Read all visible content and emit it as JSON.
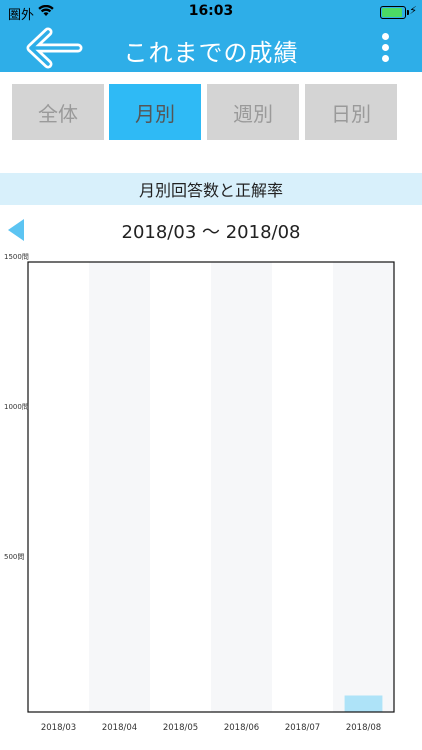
{
  "status": {
    "carrier": "圏外",
    "time": "16:03"
  },
  "nav": {
    "title": "これまでの成績",
    "back_icon": "arrow-left-icon",
    "menu_icon": "more-vertical-icon"
  },
  "tabs": [
    {
      "label": "全体",
      "active": false
    },
    {
      "label": "月別",
      "active": true
    },
    {
      "label": "週別",
      "active": false
    },
    {
      "label": "日別",
      "active": false
    }
  ],
  "section": {
    "title": "月別回答数と正解率"
  },
  "range": {
    "label": "2018/03 〜 2018/08"
  },
  "colors": {
    "accent": "#2eaee8",
    "active_tab": "#2fbaf5",
    "bar": "#aee3f8",
    "stripe": "#f6f7f9"
  },
  "chart_data": {
    "type": "bar",
    "categories": [
      "2018/03",
      "2018/04",
      "2018/05",
      "2018/06",
      "2018/07",
      "2018/08"
    ],
    "values": [
      0,
      0,
      0,
      0,
      0,
      55
    ],
    "ylim": [
      0,
      1500
    ],
    "yticks": [
      500,
      1000,
      1500
    ],
    "ytick_labels": [
      "500問",
      "1000問",
      "1500問"
    ],
    "grid": false
  }
}
